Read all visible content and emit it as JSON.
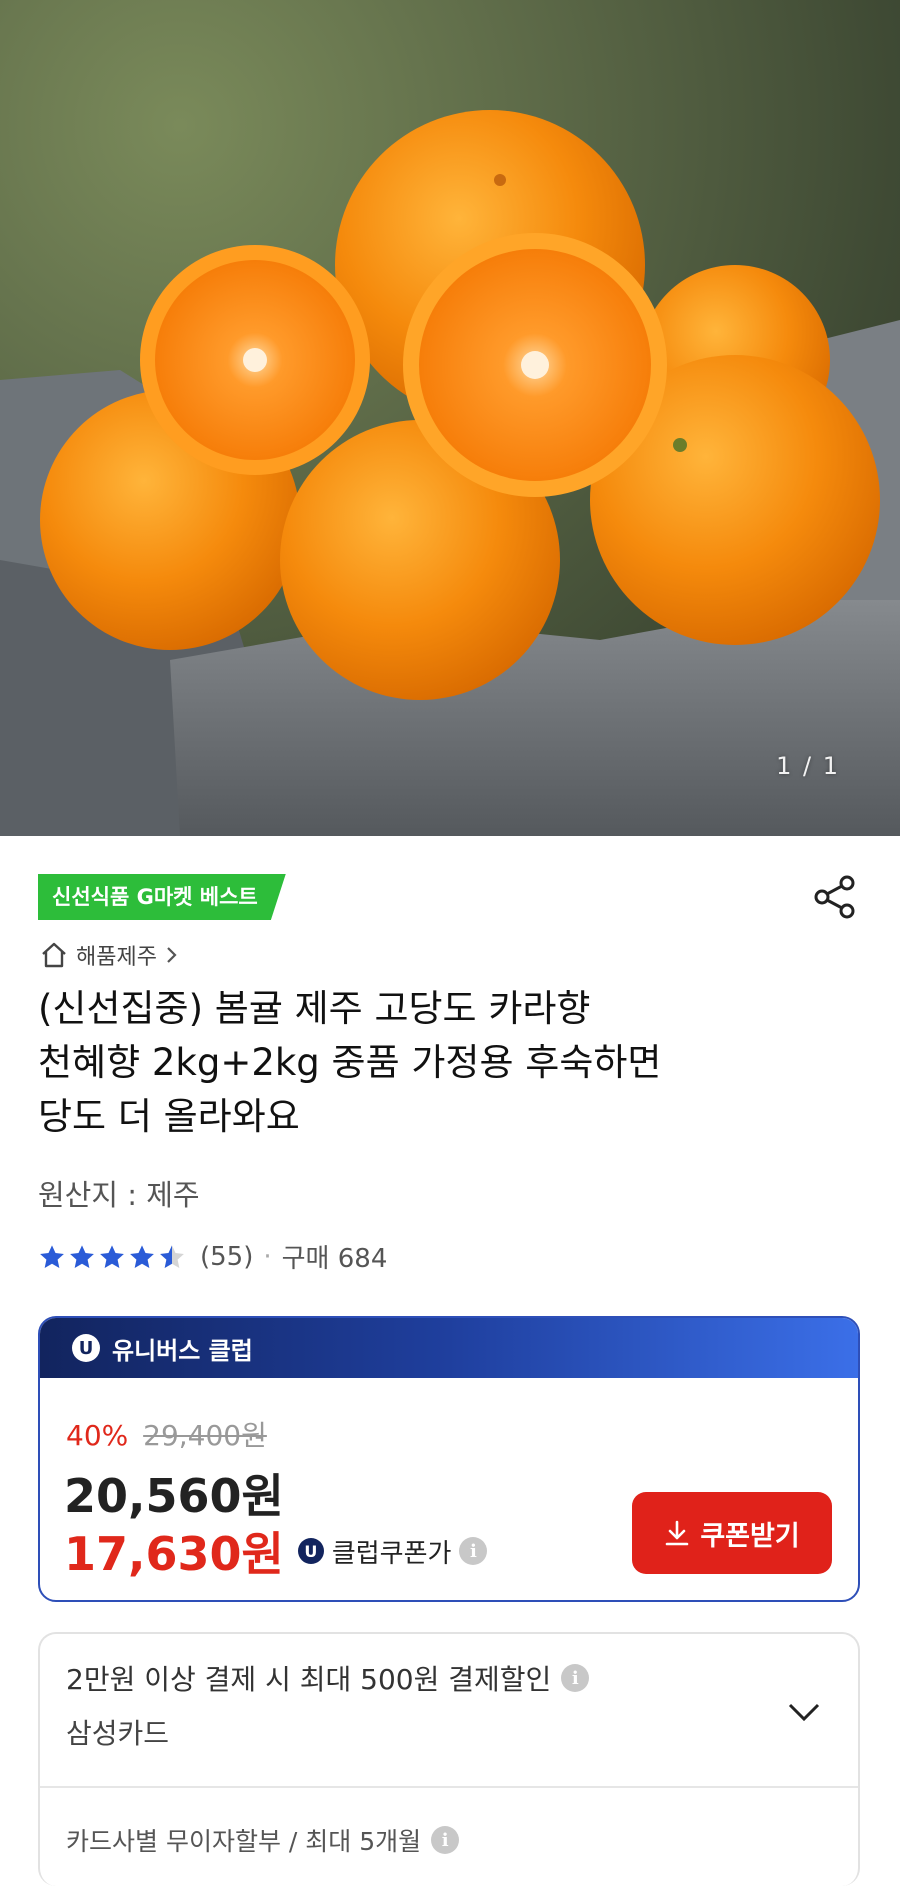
{
  "gallery": {
    "counter": "1 / 1"
  },
  "badge": "신선식품 G마켓 베스트",
  "seller": {
    "name": "해품제주"
  },
  "title_lines": [
    "(신선집중) 봄귤 제주 고당도 카라향",
    "천혜향 2kg+2kg 중품 가정용 후숙하면",
    "당도 더 올라와요"
  ],
  "origin": "원산지 : 제주",
  "rating": {
    "stars": 4.5,
    "count": "(55)",
    "purchases": "구매 684"
  },
  "club": {
    "header": "유니버스 클럽",
    "discount_percent": "40%",
    "original_price": "29,400원",
    "price": "20,560원",
    "club_price": "17,630원",
    "club_price_label": "클럽쿠폰가",
    "coupon_button": "쿠폰받기"
  },
  "payment": {
    "discount_text": "2만원 이상 결제 시 최대 500원 결제할인",
    "card": "삼성카드",
    "installment": "카드사별 무이자할부 / 최대 5개월"
  },
  "colors": {
    "accent_red": "#e0281b",
    "badge_green": "#2dbd3a",
    "club_navy": "#12245e"
  }
}
